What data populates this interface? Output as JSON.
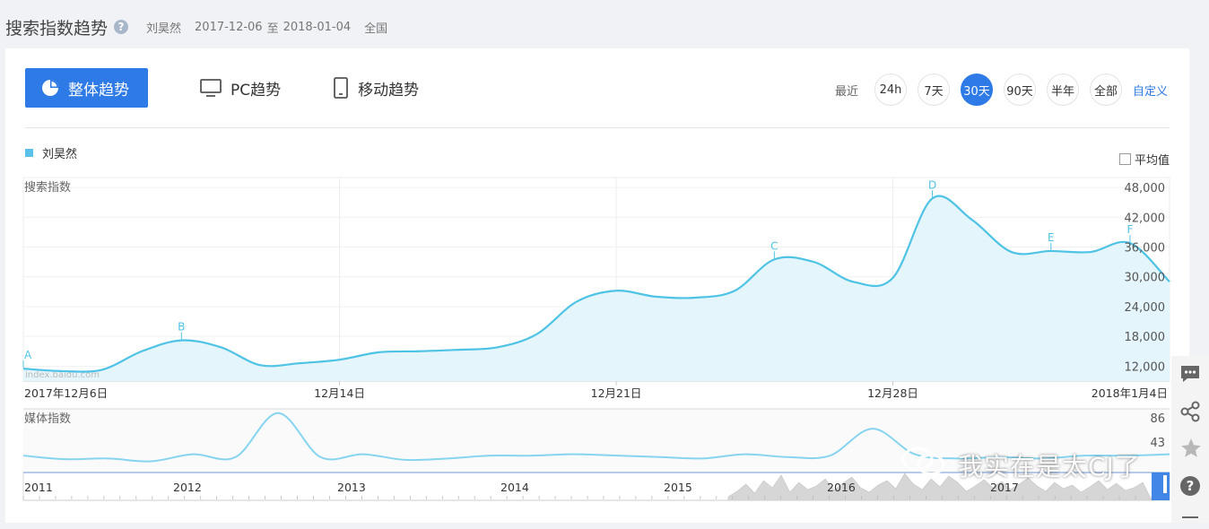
{
  "header": {
    "title": "搜索指数趋势",
    "help": "?",
    "keyword": "刘昊然",
    "date_from": "2017-12-06",
    "date_sep": "至",
    "date_to": "2018-01-04",
    "region": "全国"
  },
  "tabs": [
    {
      "label": "整体趋势",
      "active": true
    },
    {
      "label": "PC趋势",
      "active": false
    },
    {
      "label": "移动趋势",
      "active": false
    }
  ],
  "range": {
    "label": "最近",
    "options": [
      "24h",
      "7天",
      "30天",
      "90天",
      "半年",
      "全部"
    ],
    "active": "30天",
    "custom": "自定义"
  },
  "legend": {
    "name": "刘昊然",
    "color": "#5bc1ea"
  },
  "average_toggle": {
    "label": "平均值",
    "checked": false
  },
  "chart_data": {
    "type": "area",
    "ylabel": "搜索指数",
    "y_ticks": [
      "48,000",
      "42,000",
      "36,000",
      "30,000",
      "24,000",
      "18,000",
      "12,000"
    ],
    "x_labels": [
      "2017年12月6日",
      "12月14日",
      "12月21日",
      "12月28日",
      "2018年1月4日"
    ],
    "watermark": "index.baidu.com",
    "series": [
      {
        "name": "刘昊然",
        "color": "#4ec3e6",
        "values": [
          {
            "x": "2017-12-06",
            "y": 11500
          },
          {
            "x": "2017-12-07",
            "y": 11000
          },
          {
            "x": "2017-12-08",
            "y": 11300
          },
          {
            "x": "2017-12-09",
            "y": 15000
          },
          {
            "x": "2017-12-10",
            "y": 17200
          },
          {
            "x": "2017-12-11",
            "y": 15800
          },
          {
            "x": "2017-12-12",
            "y": 12200
          },
          {
            "x": "2017-12-13",
            "y": 12600
          },
          {
            "x": "2017-12-14",
            "y": 13300
          },
          {
            "x": "2017-12-15",
            "y": 14800
          },
          {
            "x": "2017-12-16",
            "y": 15000
          },
          {
            "x": "2017-12-17",
            "y": 15300
          },
          {
            "x": "2017-12-18",
            "y": 15800
          },
          {
            "x": "2017-12-19",
            "y": 18500
          },
          {
            "x": "2017-12-20",
            "y": 25000
          },
          {
            "x": "2017-12-21",
            "y": 27200
          },
          {
            "x": "2017-12-22",
            "y": 26000
          },
          {
            "x": "2017-12-23",
            "y": 25800
          },
          {
            "x": "2017-12-24",
            "y": 27200
          },
          {
            "x": "2017-12-25",
            "y": 33500
          },
          {
            "x": "2017-12-26",
            "y": 33000
          },
          {
            "x": "2017-12-27",
            "y": 29000
          },
          {
            "x": "2017-12-28",
            "y": 29800
          },
          {
            "x": "2017-12-29",
            "y": 45800
          },
          {
            "x": "2017-12-30",
            "y": 41500
          },
          {
            "x": "2017-12-31",
            "y": 35000
          },
          {
            "x": "2018-01-01",
            "y": 35200
          },
          {
            "x": "2018-01-02",
            "y": 35000
          },
          {
            "x": "2018-01-03",
            "y": 36800
          },
          {
            "x": "2018-01-04",
            "y": 29000
          }
        ]
      }
    ],
    "annotations": [
      {
        "label": "A",
        "x": "2017-12-06"
      },
      {
        "label": "B",
        "x": "2017-12-10"
      },
      {
        "label": "C",
        "x": "2017-12-25"
      },
      {
        "label": "D",
        "x": "2017-12-29"
      },
      {
        "label": "E",
        "x": "2018-01-01"
      },
      {
        "label": "F",
        "x": "2018-01-03"
      }
    ],
    "media": {
      "ylabel": "媒体指数",
      "y_ticks": [
        "86",
        "43"
      ],
      "values": [
        20,
        15,
        16,
        12,
        22,
        18,
        80,
        18,
        22,
        14,
        16,
        20,
        20,
        22,
        20,
        18,
        16,
        22,
        18,
        20,
        58,
        22,
        16,
        18,
        16,
        20,
        20,
        22
      ]
    },
    "overview": {
      "year_labels": [
        "2011",
        "2012",
        "2013",
        "2014",
        "2015",
        "2016",
        "2017"
      ]
    }
  },
  "watermark_text": "我实在是太CJ了"
}
